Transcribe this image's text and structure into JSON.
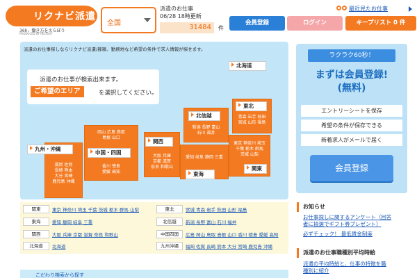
{
  "header": {
    "logo_text": "リクナビ派遣",
    "logo_tagline": "36h、働き方をえらぼう",
    "logo_sub": "PRODUCED BY RECRUIT",
    "region": "全国",
    "info_line1": "派遣のお仕事",
    "info_line2": "06/28 18時更新",
    "job_count": "31484",
    "job_unit": "件",
    "recent_link": "最近見たお仕事",
    "btn_register": "会員登録",
    "btn_login": "ログイン",
    "btn_keep": "キープリスト 0 件"
  },
  "map": {
    "lead": "派遣のお仕事探しならリクナビ派遣/稼稼、勤務地など希望の条件で求人情報が探せます。",
    "speech_line1": "派遣のお仕事が検索出来ます。",
    "speech_area": "ご希望のエリア",
    "speech_line2": "を選択してください。",
    "regions": {
      "hokkaido": "北海道",
      "tohoku": "東北",
      "tohoku_prefs": [
        "青森 岩手 秋田",
        "宮城 山形 福島"
      ],
      "hokushinetsu": "北信越",
      "hokushinetsu_prefs": [
        "新潟 長野 富山",
        "石川 福井"
      ],
      "kanto": "関東",
      "kanto_prefs": [
        "東京 神奈川 埼玉",
        "千葉 栃木 群馬",
        "茨城 山梨"
      ],
      "tokai": "東海",
      "tokai_prefs": [
        "愛知 岐阜 静岡 三重"
      ],
      "kansai": "関西",
      "kansai_prefs": [
        "大阪 兵庫",
        "京都 滋賀",
        "奈良 和歌山"
      ],
      "chugoku": "中国・四国",
      "chugoku_prefs": [
        "岡山 広島 鳥取",
        "島根 山口"
      ],
      "shikoku_prefs": [
        "香川 徳島",
        "愛媛 高知"
      ],
      "kyushu": "九州・沖縄",
      "kyushu_prefs": [
        "福岡 佐賀",
        "長崎 熊本",
        "大分 宮崎",
        "鹿児島 沖縄"
      ]
    }
  },
  "pref_table": {
    "left": [
      {
        "head": "関東",
        "links": "東京 神奈川 埼玉 千葉 茨城 栃木 群馬 山梨"
      },
      {
        "head": "東海",
        "links": "愛知 静岡 岐阜 三重"
      },
      {
        "head": "関西",
        "links": "大阪 兵庫 京都 滋賀 奈良 和歌山"
      },
      {
        "head": "北海道",
        "links": "北海道"
      }
    ],
    "right": [
      {
        "head": "東北",
        "links": "宮城 青森 岩手 秋田 山形 福島"
      },
      {
        "head": "北信越",
        "links": "新潟 長野 富山 石川 福井"
      },
      {
        "head": "中国四国",
        "links": "広島 岡山 鳥取 島根 山口 香川 徳島 愛媛 高知"
      },
      {
        "head": "九州沖縄",
        "links": "福岡 佐賀 長崎 熊本 大分 宮崎 鹿児島 沖縄"
      }
    ],
    "footer_link": "こだわり検索から探す"
  },
  "sidebar": {
    "ribbon": "ラクラク60秒！",
    "head1": "まずは会員登録!",
    "head2": "(無料)",
    "items": [
      "エントリーシートを保存",
      "希望の条件が保存できる",
      "新着求人がメールで届く"
    ],
    "cta": "会員登録"
  },
  "news": {
    "title": "お知らせ",
    "line1": "お仕事探しに関するアンケート（回答",
    "line2": "者に抽選でギフト券プレゼント）",
    "line3": "必ずチェック！ 最低賃金制度",
    "title2": "派遣のお仕事職種別平均時給",
    "line4": "派遣の平均時給と、仕事の特徴を職",
    "line5": "種別に紹介"
  }
}
